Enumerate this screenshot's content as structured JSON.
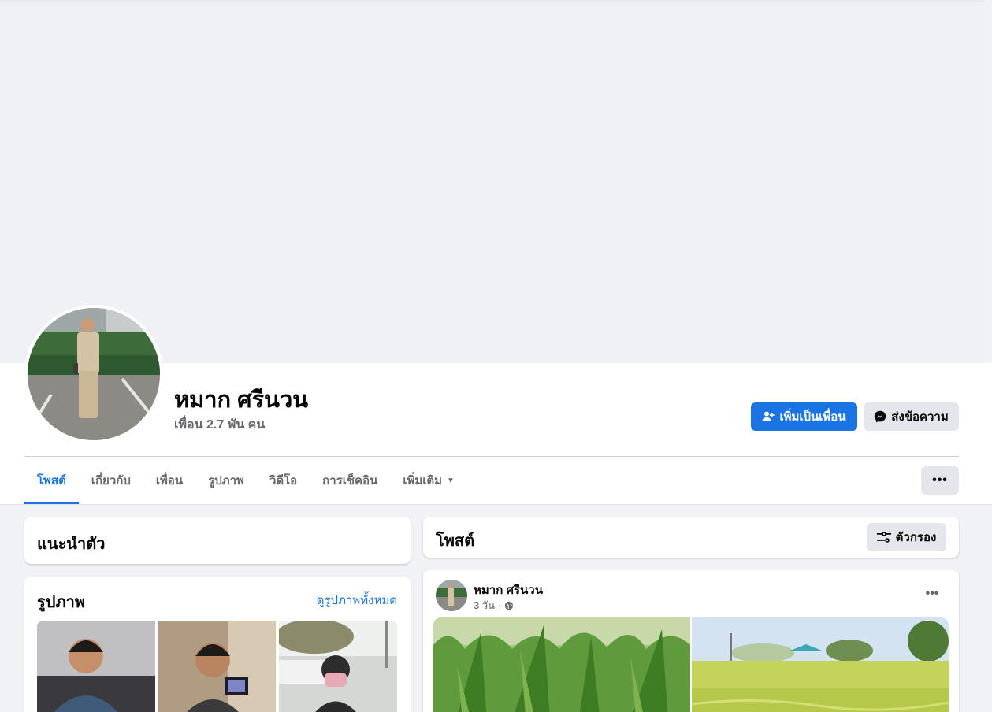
{
  "profile": {
    "name": "หมาก ศรีนวน",
    "friends_count": "เพื่อน 2.7 พัน คน"
  },
  "actions": {
    "add_friend": "เพิ่มเป็นเพื่อน",
    "message": "ส่งข้อความ",
    "more": "•••"
  },
  "tabs": [
    {
      "label": "โพสต์",
      "active": true
    },
    {
      "label": "เกี่ยวกับ",
      "active": false
    },
    {
      "label": "เพื่อน",
      "active": false
    },
    {
      "label": "รูปภาพ",
      "active": false
    },
    {
      "label": "วิดีโอ",
      "active": false
    },
    {
      "label": "การเช็คอิน",
      "active": false
    },
    {
      "label": "เพิ่มเติม",
      "active": false
    }
  ],
  "intro": {
    "title": "แนะนำตัว"
  },
  "photos": {
    "title": "รูปภาพ",
    "see_all": "ดูรูปภาพทั้งหมด"
  },
  "posts": {
    "title": "โพสต์",
    "filter_label": "ตัวกรอง",
    "items": [
      {
        "author": "หมาก ศรีนวน",
        "time": "3 วัน ·",
        "privacy_icon": "globe-icon"
      }
    ]
  },
  "colors": {
    "accent": "#1b74e4",
    "background": "#f0f2f5",
    "secondary_button": "#e4e6eb",
    "muted_text": "#65676b"
  }
}
